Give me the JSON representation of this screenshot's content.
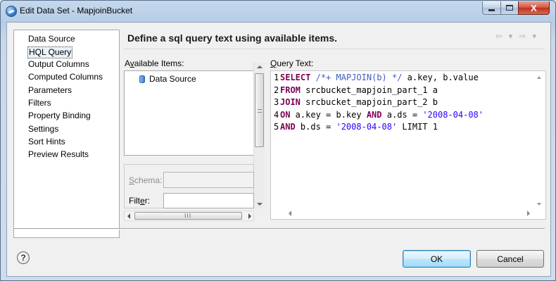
{
  "window": {
    "title": "Edit Data Set - MapjoinBucket",
    "close_glyph": "X"
  },
  "nav": {
    "items": [
      {
        "label": "Data Source"
      },
      {
        "label": "HQL Query",
        "selected": true
      },
      {
        "label": "Output Columns"
      },
      {
        "label": "Computed Columns"
      },
      {
        "label": "Parameters"
      },
      {
        "label": "Filters"
      },
      {
        "label": "Property Binding"
      },
      {
        "label": "Settings"
      },
      {
        "label": "Sort Hints"
      },
      {
        "label": "Preview Results"
      }
    ]
  },
  "page": {
    "title": "Define a sql query text using available items.",
    "history_back": "⇦",
    "history_menu": "▾",
    "history_forward": "⇨",
    "history_menu2": "▾"
  },
  "available": {
    "label_pre": "A",
    "label_mnemonic": "v",
    "label_post": "ailable Items:",
    "tree_items": [
      "Data Source"
    ]
  },
  "schema": {
    "label_mnemonic": "S",
    "label_post": "chema:",
    "value": ""
  },
  "filter": {
    "label_pre": "Filt",
    "label_mnemonic": "e",
    "label_post": "r:",
    "value": ""
  },
  "scroll": {
    "grip": "III"
  },
  "query": {
    "label_mnemonic": "Q",
    "label_post": "uery Text:",
    "lines": [
      {
        "num": "1",
        "tokens": [
          {
            "t": "SELECT",
            "c": "kw"
          },
          {
            "t": " "
          },
          {
            "t": "/*+ MAPJOIN(b) */",
            "c": "cm"
          },
          {
            "t": " a.key, b.value"
          }
        ]
      },
      {
        "num": "2",
        "tokens": [
          {
            "t": "FROM",
            "c": "kw"
          },
          {
            "t": " srcbucket_mapjoin_part_1 a"
          }
        ]
      },
      {
        "num": "3",
        "tokens": [
          {
            "t": "JOIN",
            "c": "kw"
          },
          {
            "t": " srcbucket_mapjoin_part_2 b"
          }
        ]
      },
      {
        "num": "4",
        "tokens": [
          {
            "t": "ON",
            "c": "kw"
          },
          {
            "t": " a.key = b.key "
          },
          {
            "t": "AND",
            "c": "kw"
          },
          {
            "t": " a.ds = "
          },
          {
            "t": "'2008-04-08'",
            "c": "str"
          }
        ]
      },
      {
        "num": "5",
        "tokens": [
          {
            "t": "AND",
            "c": "kw"
          },
          {
            "t": " b.ds = "
          },
          {
            "t": "'2008-04-08'",
            "c": "str"
          },
          {
            "t": " LIMIT 1"
          }
        ]
      }
    ]
  },
  "footer": {
    "help_glyph": "?",
    "ok_label": "OK",
    "cancel_label": "Cancel"
  },
  "colors": {
    "keyword": "#7f0055",
    "comment": "#3f5fbf",
    "string": "#2a00ff",
    "accent_button": "#3c7fb1"
  }
}
